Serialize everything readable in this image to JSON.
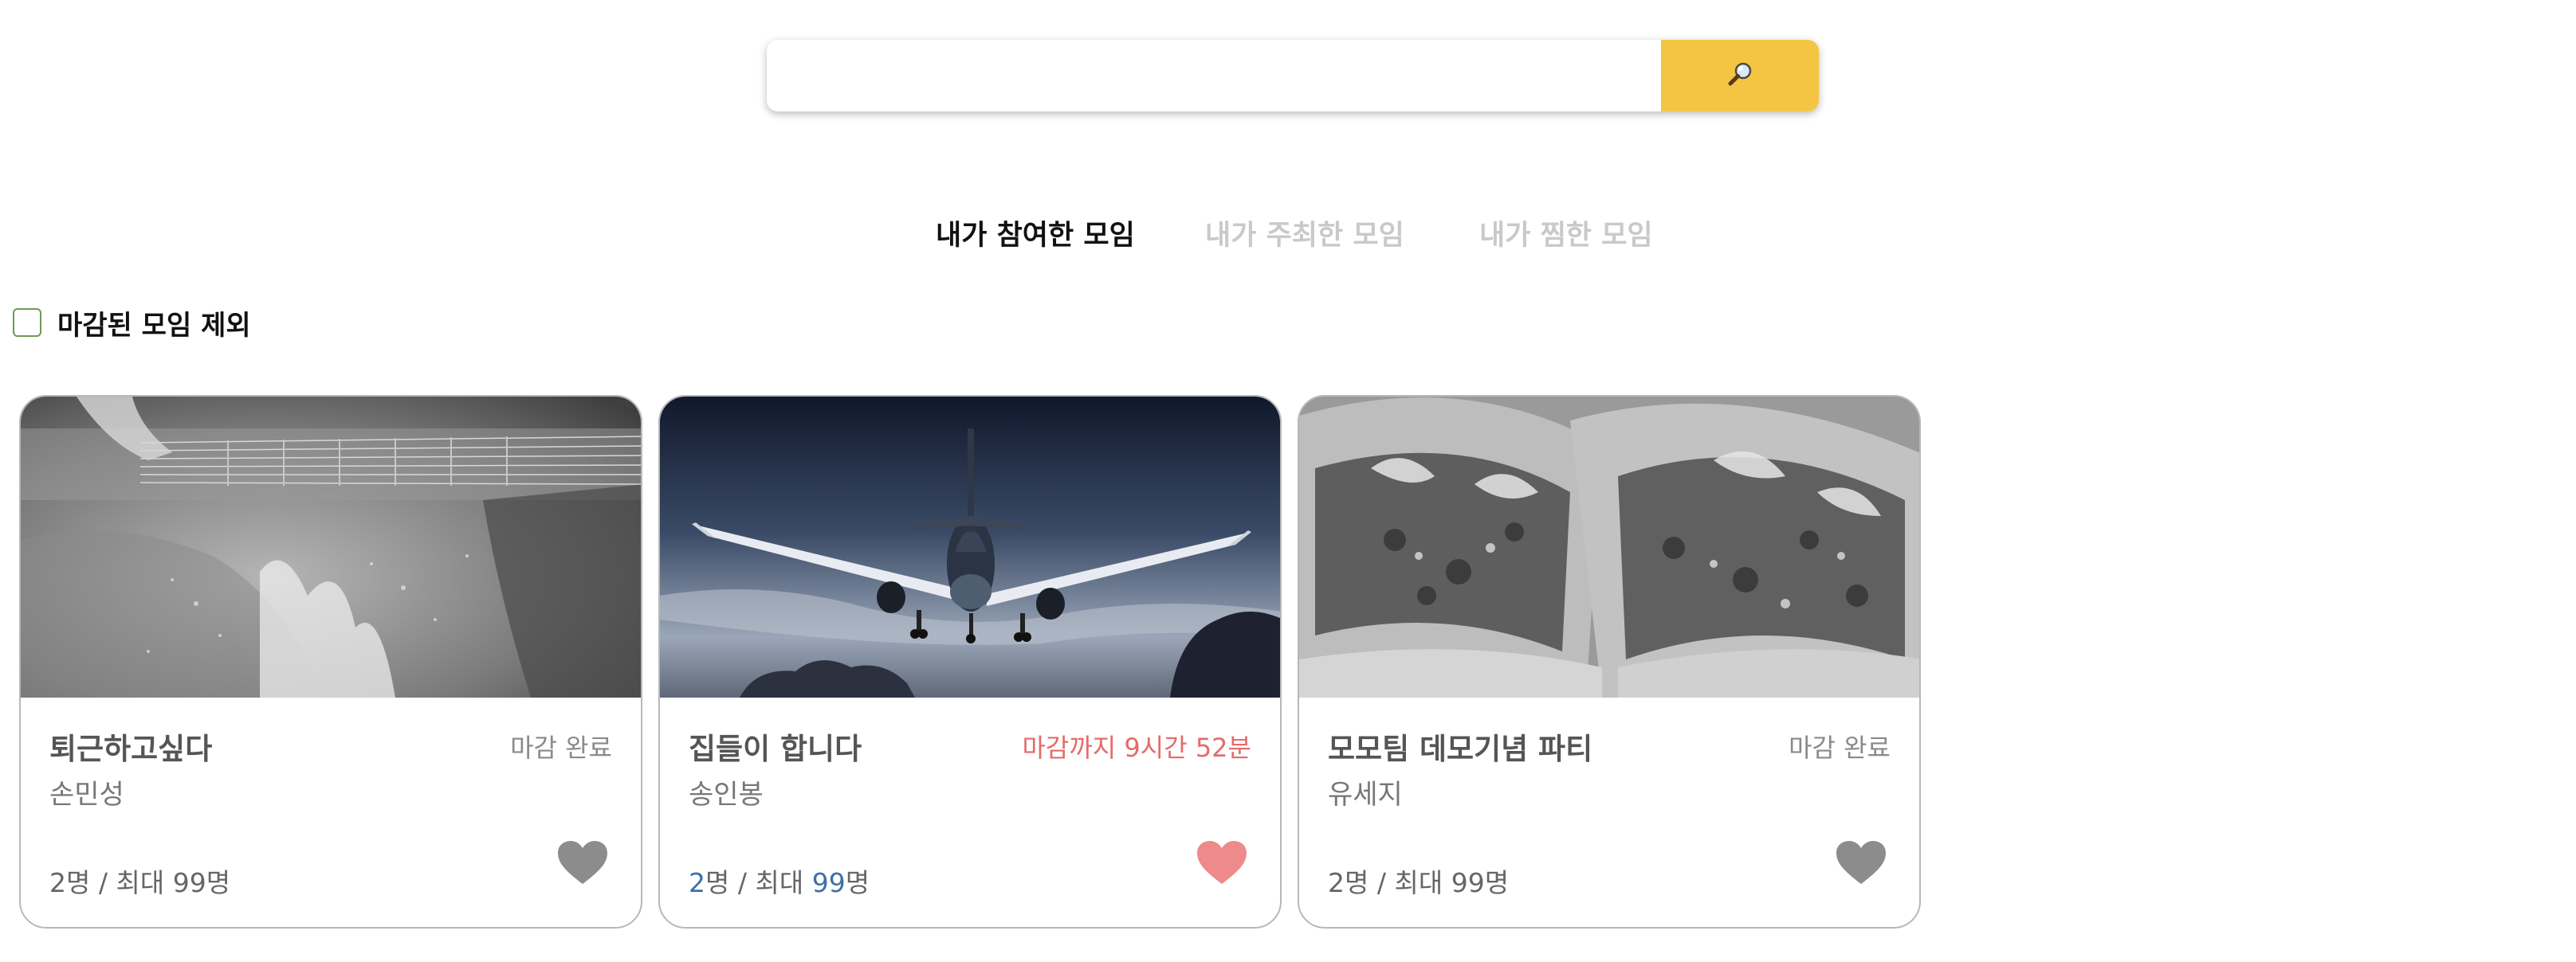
{
  "colors": {
    "search_button": "#f4c542",
    "tab_active": "#111111",
    "tab_inactive": "#c9c9c9",
    "status_closed": "#8a8a8a",
    "status_deadline": "#e66a6a",
    "heart_off": "#8c8c8c",
    "heart_on": "#ee8a8a",
    "count_highlight": "#3d6fa6"
  },
  "search": {
    "value": "",
    "placeholder": "",
    "button_icon": "magnifier-icon"
  },
  "tabs": [
    {
      "label": "내가 참여한 모임",
      "active": true
    },
    {
      "label": "내가 주최한 모임",
      "active": false
    },
    {
      "label": "내가 찜한 모임",
      "active": false
    }
  ],
  "filter": {
    "label": "마감된 모임 제외",
    "checked": false
  },
  "cards": [
    {
      "title": "퇴근하고싶다",
      "host": "손민성",
      "status": "마감 완료",
      "count": "2명",
      "separator": "/",
      "max_prefix": "최대",
      "max": "99명",
      "image": "guitar-photo",
      "liked": false
    },
    {
      "title": "집들이 합니다",
      "host": "송인봉",
      "status": "마감까지 9시간 52분",
      "count_num": "2",
      "count_unit": "명",
      "separator": "/",
      "max_prefix": "최대",
      "max_num": "99",
      "max_unit": "명",
      "image": "airplane-photo",
      "liked": true
    },
    {
      "title": "모모팀 데모기념 파티",
      "host": "유세지",
      "status": "마감 완료",
      "count": "2명",
      "separator": "/",
      "max_prefix": "최대",
      "max": "99명",
      "image": "tacos-photo",
      "liked": false
    }
  ]
}
